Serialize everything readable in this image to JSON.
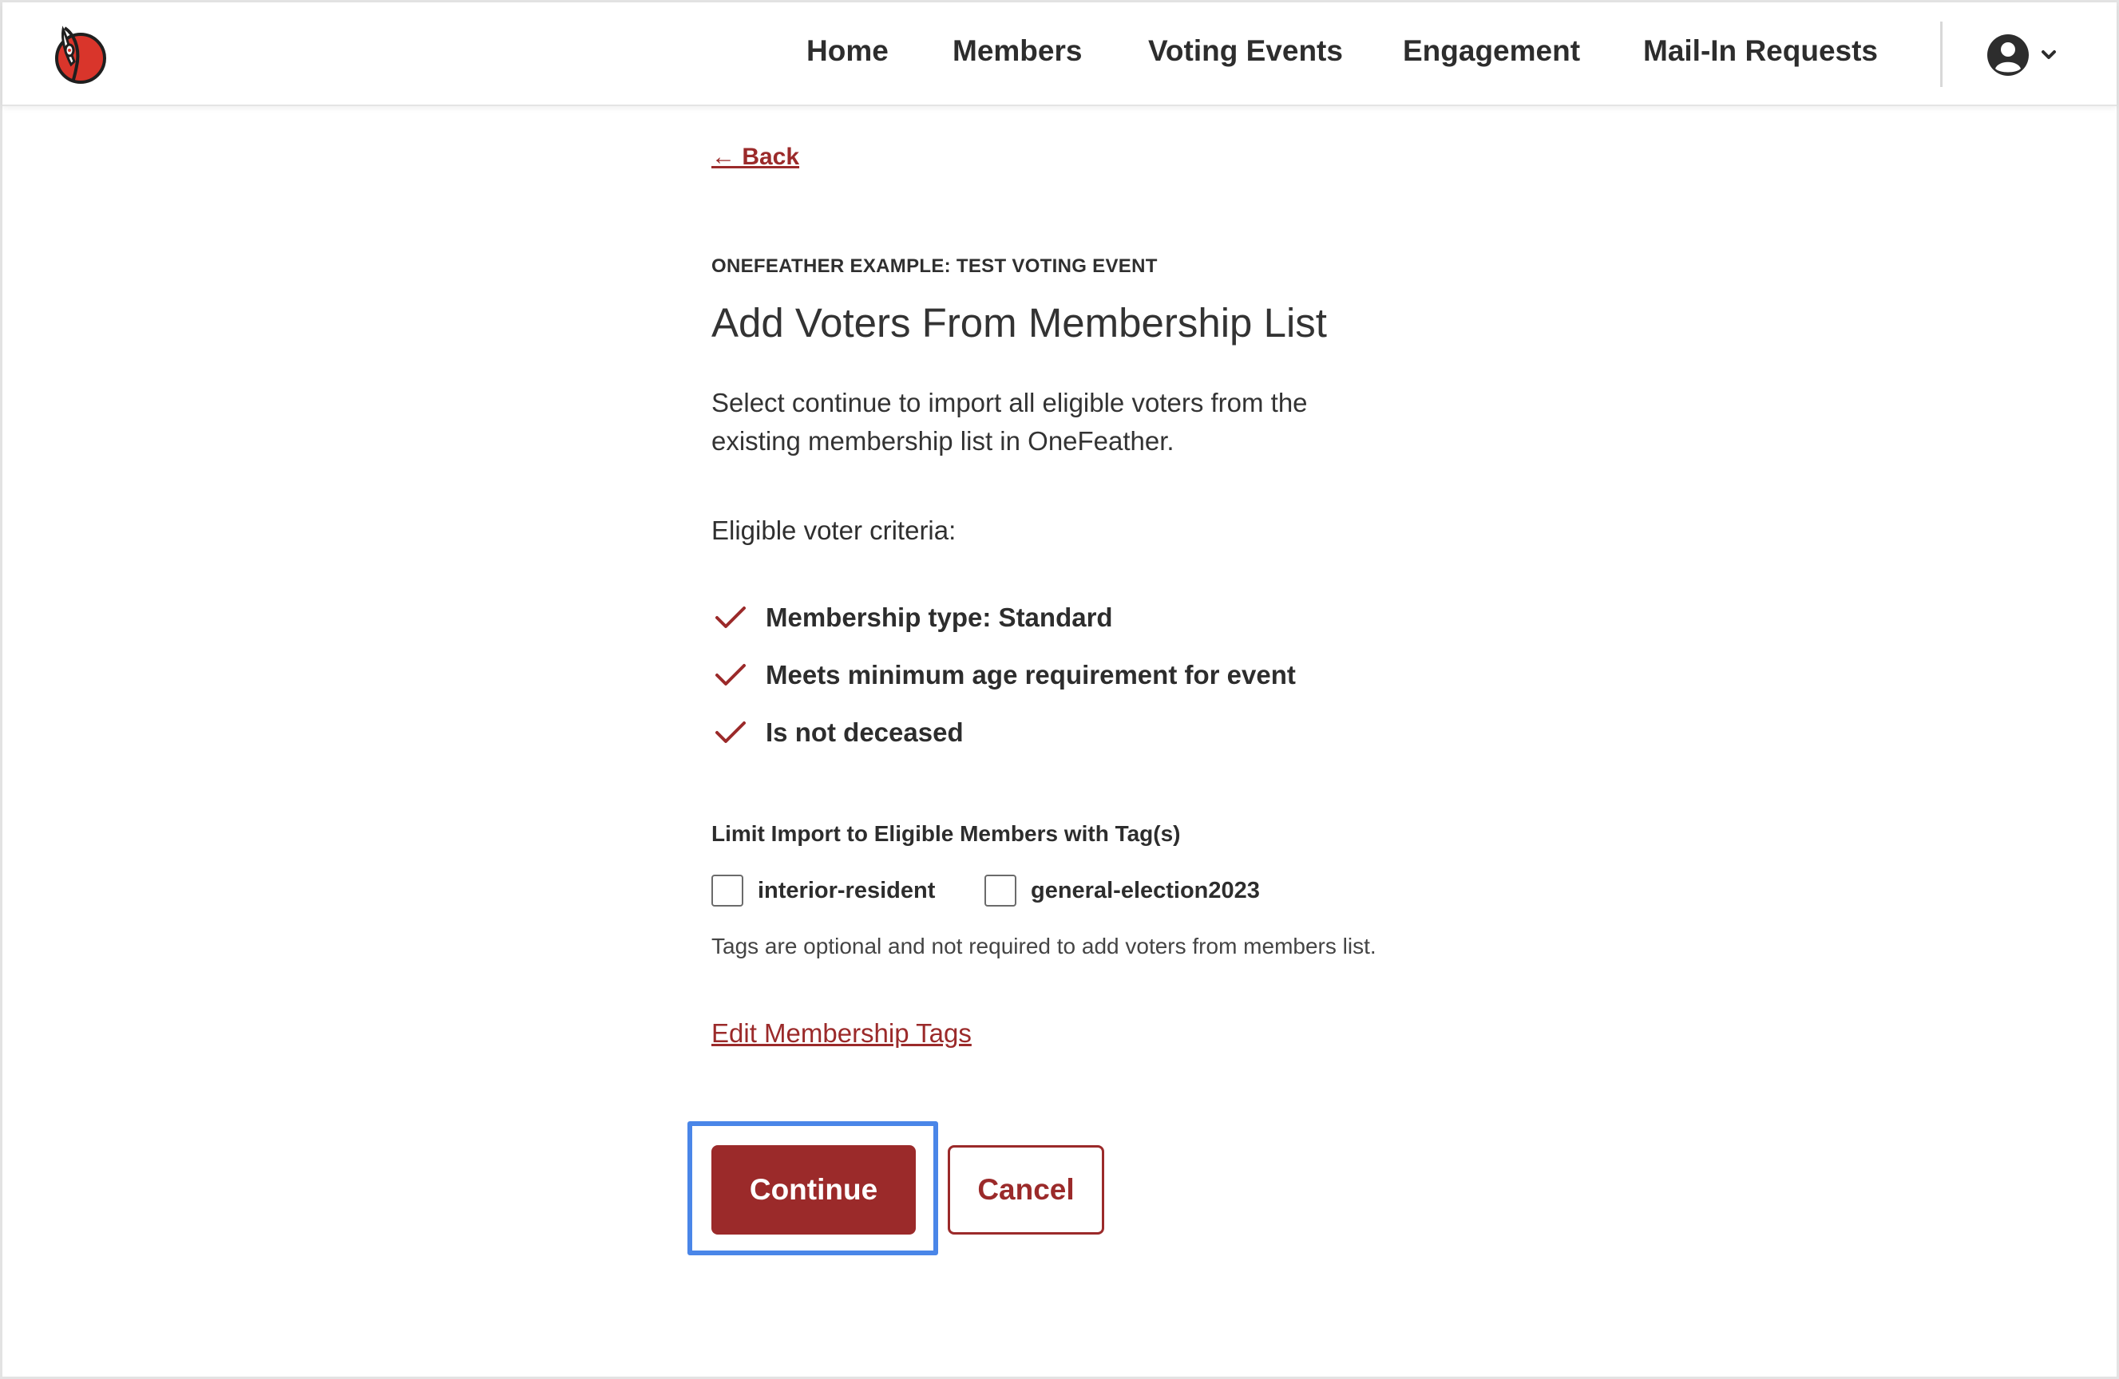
{
  "header": {
    "logo_icon": "feather-logo-icon",
    "nav": [
      {
        "label": "Home"
      },
      {
        "label": "Members"
      },
      {
        "label": "Voting Events"
      },
      {
        "label": "Engagement"
      },
      {
        "label": "Mail-In Requests"
      }
    ],
    "account_icon": "user-circle-icon",
    "account_menu_icon": "chevron-down-icon"
  },
  "page": {
    "back_label": "← Back",
    "eyebrow": "ONEFEATHER EXAMPLE: TEST VOTING EVENT",
    "title": "Add Voters From Membership List",
    "description": "Select continue to import all eligible voters from the existing membership list in OneFeather.",
    "criteria_label": "Eligible voter criteria:",
    "criteria": [
      {
        "text": "Membership type: Standard",
        "icon": "checkmark-icon"
      },
      {
        "text": "Meets minimum age requirement for event",
        "icon": "checkmark-icon"
      },
      {
        "text": "Is not deceased",
        "icon": "checkmark-icon"
      }
    ],
    "tags_label": "Limit Import to Eligible Members with Tag(s)",
    "tags": [
      {
        "label": "interior-resident",
        "checked": false
      },
      {
        "label": "general-election2023",
        "checked": false
      }
    ],
    "tags_note": "Tags are optional and not required to add voters from members list.",
    "edit_tags_label": "Edit Membership Tags",
    "continue_label": "Continue",
    "cancel_label": "Cancel"
  },
  "colors": {
    "brand": "#9b2a2a",
    "focus": "#4a86e8",
    "text": "#2d2d2d"
  }
}
